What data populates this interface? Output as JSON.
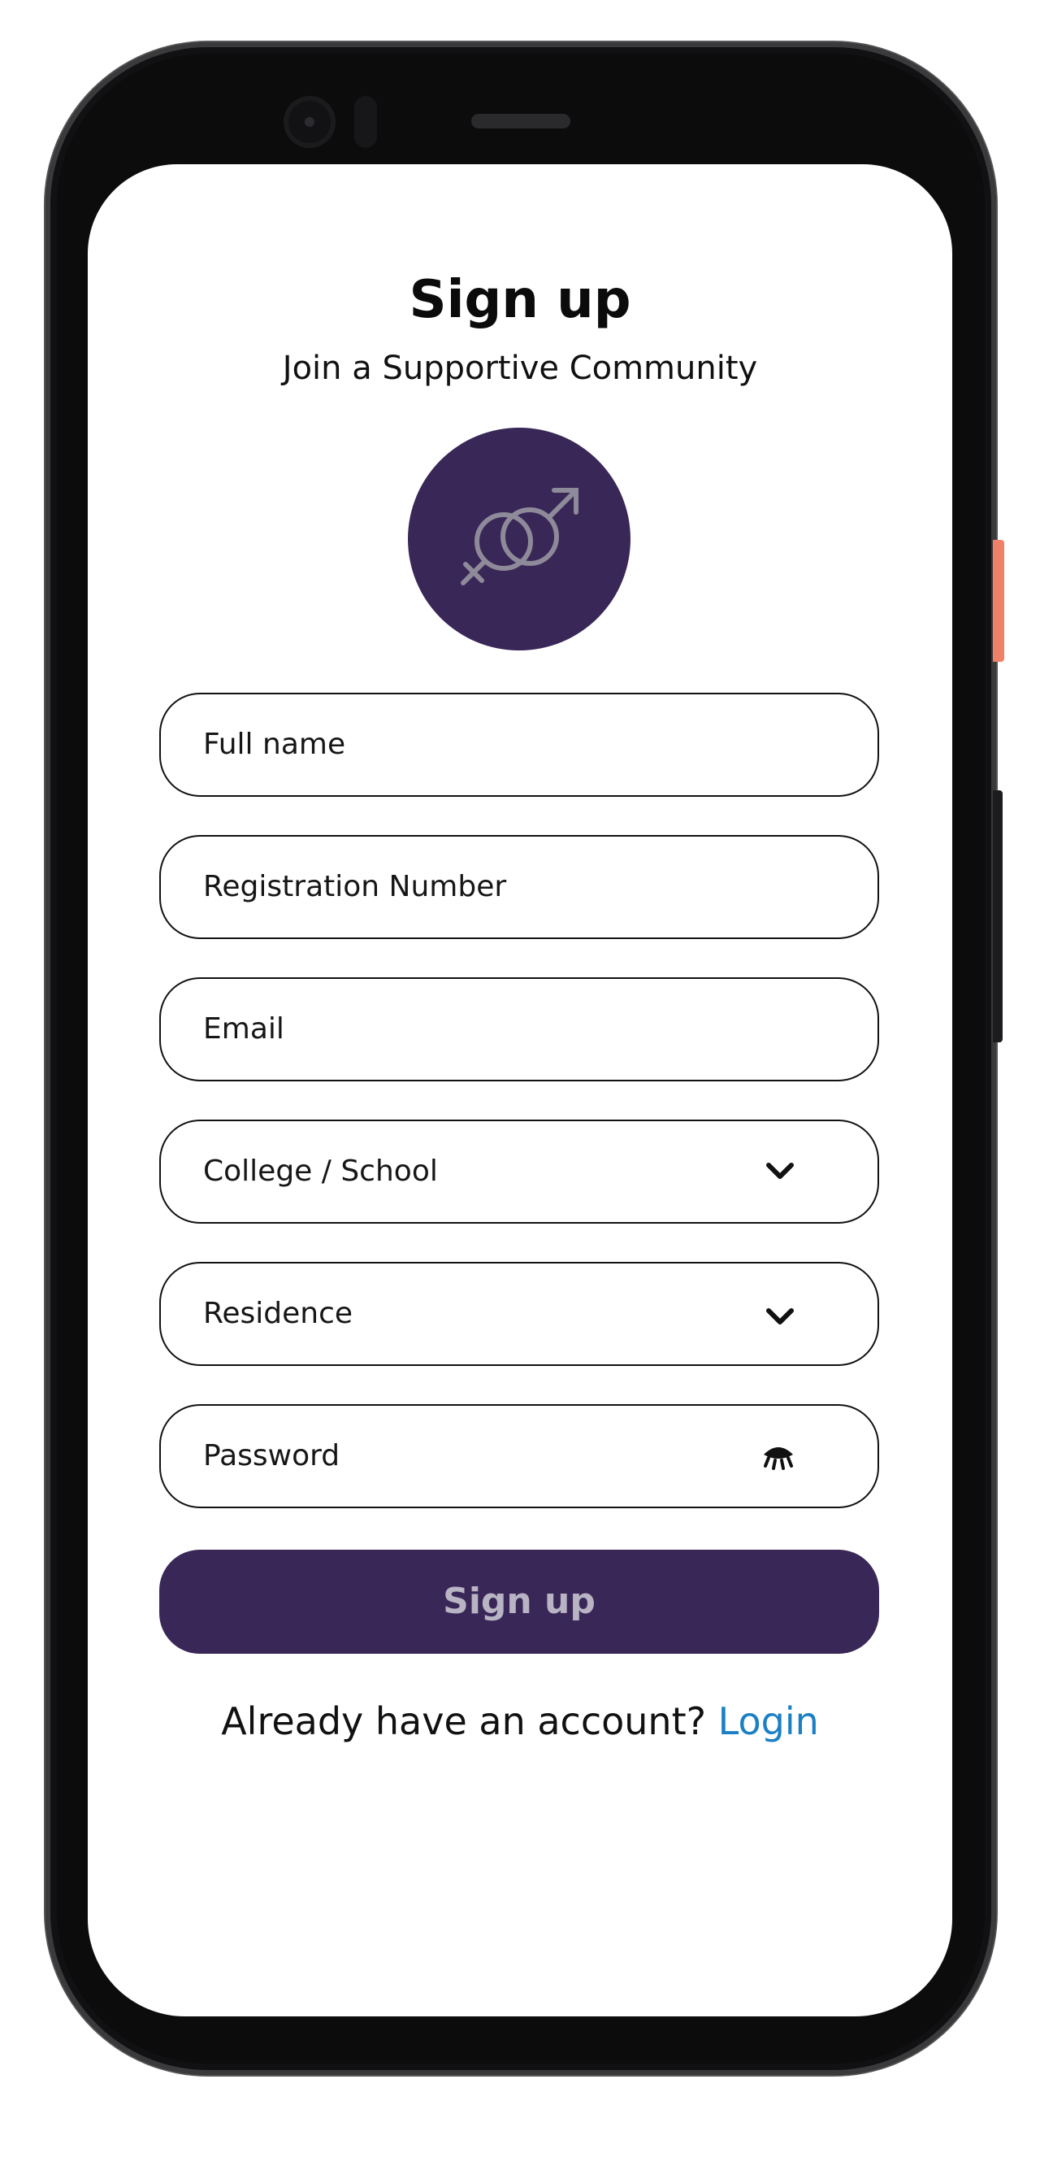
{
  "header": {
    "title": "Sign up",
    "subtitle": "Join a Supportive Community"
  },
  "avatar": {
    "icon": "gender-symbols-icon",
    "background": "#392758"
  },
  "form": {
    "full_name_placeholder": "Full name",
    "registration_placeholder": "Registration Number",
    "email_placeholder": "Email",
    "college_placeholder": "College / School",
    "residence_placeholder": "Residence",
    "password_placeholder": "Password"
  },
  "actions": {
    "signup_label": "Sign up",
    "login_prompt": "Already have an account?",
    "login_link": "Login"
  },
  "colors": {
    "primary": "#392758",
    "link": "#1b7fc4",
    "button_text": "#b9b4c4"
  }
}
